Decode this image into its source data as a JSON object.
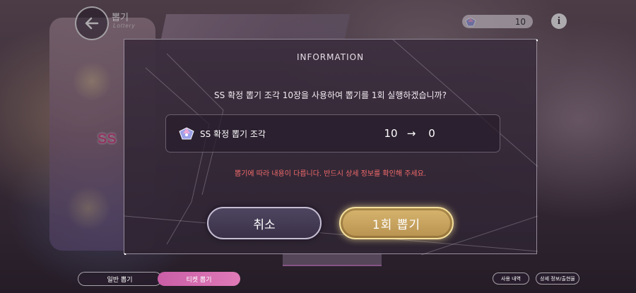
{
  "header": {
    "title": "뽑기",
    "subtitle": "Lottery",
    "currency_value": "10"
  },
  "background": {
    "ss_badge": "SS"
  },
  "modal": {
    "title": "INFORMATION",
    "question": "SS 확정 뽑기 조각 10장을 사용하여 뽑기를 1회 실행하겠습니까?",
    "item_name": "SS 확정 뽑기 조각",
    "item_from": "10",
    "item_to": "0",
    "warning": "뽑기에 따라 내용이 다릅니다. 반드시 상세 정보를 확인해 주세요.",
    "cancel_label": "취소",
    "confirm_label": "1회 뽑기"
  },
  "bottom": {
    "tab_normal": "일반 뽑기",
    "tab_ticket": "티켓 뽑기",
    "history_label": "사용 내역",
    "details_label": "상세 정보/출현율"
  },
  "colors": {
    "confirm_gold": "#d7b56e",
    "warning_red": "#f26a6a",
    "ticket_tab_pink": "#c95ea6"
  },
  "icons": [
    "back-arrow-icon",
    "piece-gem-icon",
    "info-icon"
  ]
}
